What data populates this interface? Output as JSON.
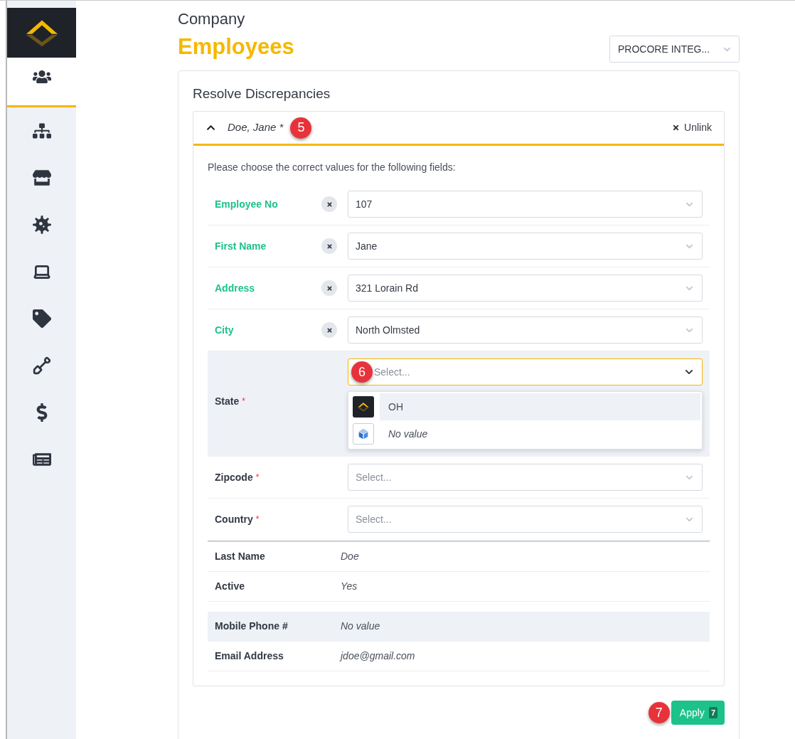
{
  "sidebar": {
    "items": [
      {
        "selected": true
      },
      {
        "selected": false
      },
      {
        "selected": false
      },
      {
        "selected": false
      },
      {
        "selected": false
      },
      {
        "selected": false
      },
      {
        "selected": false
      },
      {
        "selected": false
      },
      {
        "selected": false
      }
    ]
  },
  "header": {
    "subtitle": "Company",
    "title": "Employees",
    "integration_select": {
      "value": "PROCORE INTEG..."
    }
  },
  "card": {
    "title": "Resolve Discrepancies",
    "record": {
      "name": "Doe, Jane *",
      "expanded": true,
      "callout": "5",
      "unlink": "Unlink",
      "instructions": "Please choose the correct values for the following fields:",
      "fields": [
        {
          "kind": "resolved",
          "label": "Employee No",
          "value": "107"
        },
        {
          "kind": "resolved",
          "label": "First Name",
          "value": "Jane"
        },
        {
          "kind": "resolved",
          "label": "Address",
          "value": "321 Lorain Rd"
        },
        {
          "kind": "resolved",
          "label": "City",
          "value": "North Olmsted"
        },
        {
          "kind": "required",
          "label": "State",
          "required_mark": "*",
          "placeholder": "Select...",
          "open": true,
          "callout": "6",
          "options": [
            {
              "kind": "lumber",
              "label": "OH",
              "selected": true,
              "empty": false
            },
            {
              "kind": "procore",
              "label": "No value",
              "selected": false,
              "empty": true
            }
          ]
        },
        {
          "kind": "required",
          "label": "Zipcode",
          "required_mark": "*",
          "placeholder": "Select...",
          "open": false
        },
        {
          "kind": "required",
          "label": "Country",
          "required_mark": "*",
          "placeholder": "Select...",
          "open": false
        }
      ],
      "details": [
        {
          "label": "Last Name",
          "value": "Doe",
          "highlighted": false
        },
        {
          "label": "Active",
          "value": "Yes",
          "highlighted": false
        },
        {
          "label": "Mobile Phone #",
          "value": "No value",
          "highlighted": true
        },
        {
          "label": "Email Address",
          "value": "jdoe@gmail.com",
          "highlighted": false
        }
      ]
    },
    "apply": {
      "label": "Apply",
      "count": "7",
      "callout": "7"
    }
  }
}
